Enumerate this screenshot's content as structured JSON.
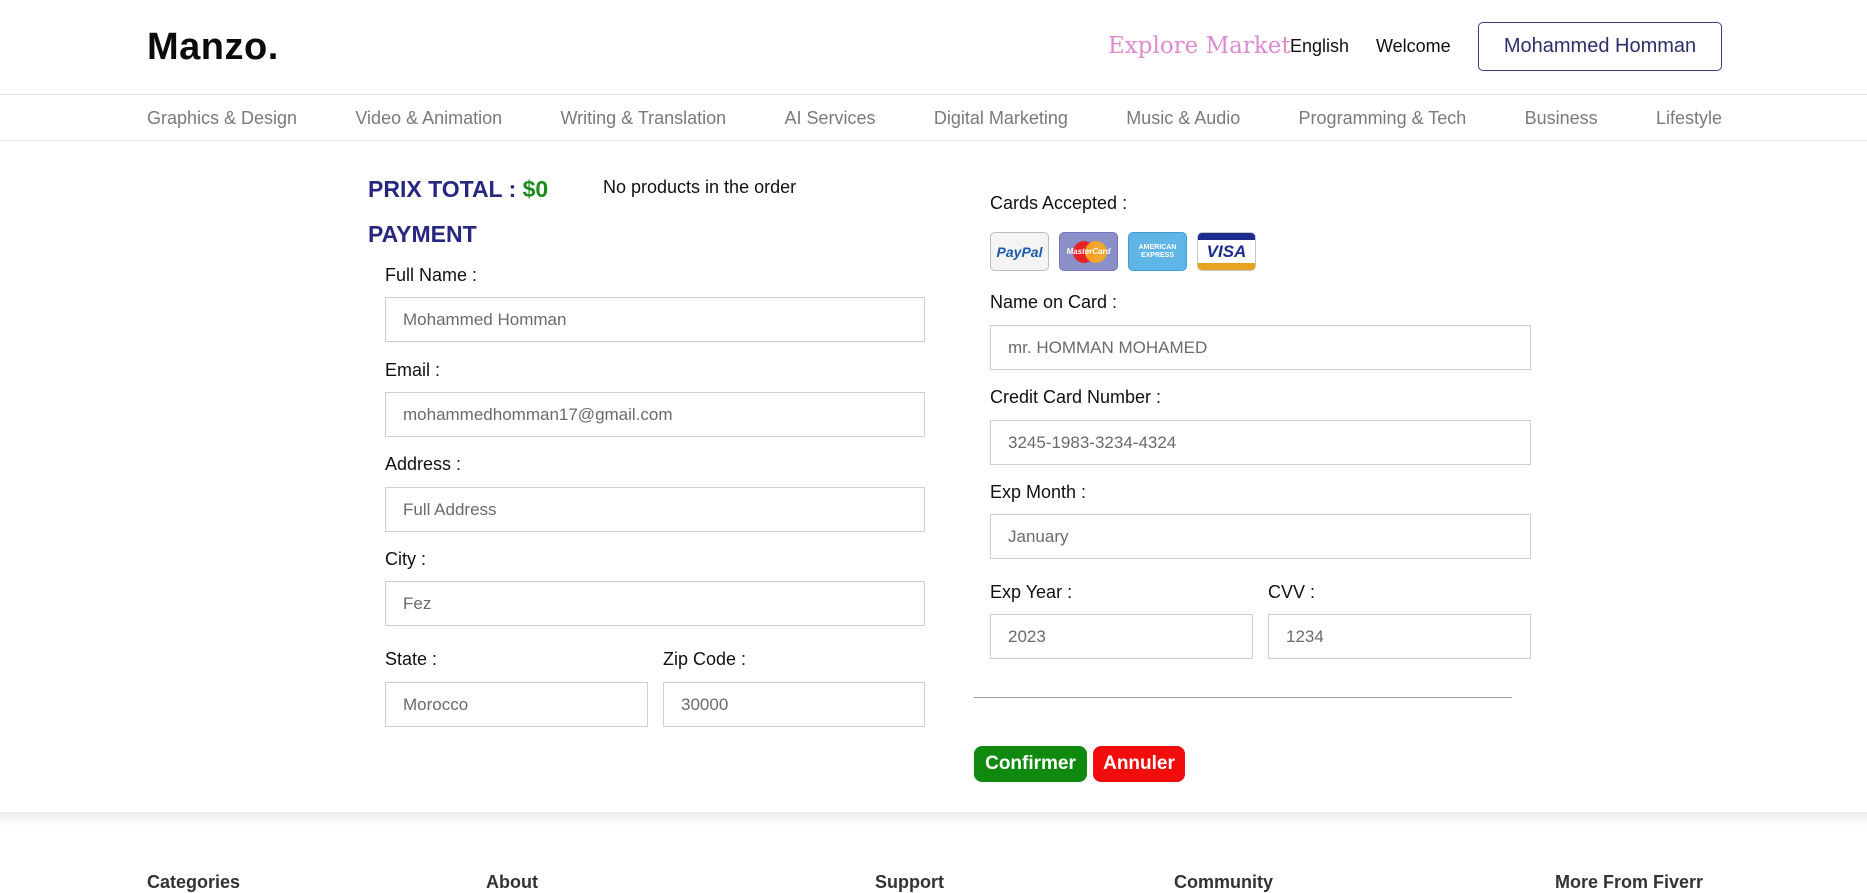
{
  "header": {
    "logo": "Manzo.",
    "explore": "Explore Market",
    "language": "English",
    "welcome": "Welcome",
    "user_button": "Mohammed Homman"
  },
  "categories": [
    "Graphics & Design",
    "Video & Animation",
    "Writing & Translation",
    "AI Services",
    "Digital Marketing",
    "Music & Audio",
    "Programming & Tech",
    "Business",
    "Lifestyle"
  ],
  "order": {
    "prix_label": "PRIX TOTAL :",
    "prix_amount": "$0",
    "status": "No products in the order",
    "payment_title": "PAYMENT"
  },
  "billing": {
    "full_name": {
      "label": "Full Name :",
      "placeholder": "Mohammed Homman"
    },
    "email": {
      "label": "Email :",
      "placeholder": "mohammedhomman17@gmail.com"
    },
    "address": {
      "label": "Address :",
      "placeholder": "Full Address"
    },
    "city": {
      "label": "City :",
      "placeholder": "Fez"
    },
    "state": {
      "label": "State :",
      "placeholder": "Morocco"
    },
    "zip": {
      "label": "Zip Code :",
      "placeholder": "30000"
    }
  },
  "card": {
    "accepted_label": "Cards Accepted :",
    "brands": {
      "paypal": "PayPal",
      "mastercard": "MasterCard",
      "amex": "AMERICAN EXPRESS",
      "visa": "VISA"
    },
    "name_on_card": {
      "label": "Name on Card :",
      "placeholder": "mr. HOMMAN MOHAMED"
    },
    "number": {
      "label": "Credit Card Number :",
      "placeholder": "3245-1983-3234-4324"
    },
    "exp_month": {
      "label": "Exp Month :",
      "placeholder": "January"
    },
    "exp_year": {
      "label": "Exp Year :",
      "placeholder": "2023"
    },
    "cvv": {
      "label": "CVV :",
      "placeholder": "1234"
    }
  },
  "actions": {
    "confirm": "Confirmer",
    "cancel": "Annuler"
  },
  "footer": {
    "headings": [
      "Categories",
      "About",
      "Support",
      "Community",
      "More From Fiverr"
    ]
  },
  "colors": {
    "title_blue": "#27277f",
    "amount_green": "#1c8a1c",
    "explore_pink": "#e08ad0",
    "confirm_green": "#0f8a0f",
    "cancel_red": "#f20d0d"
  }
}
